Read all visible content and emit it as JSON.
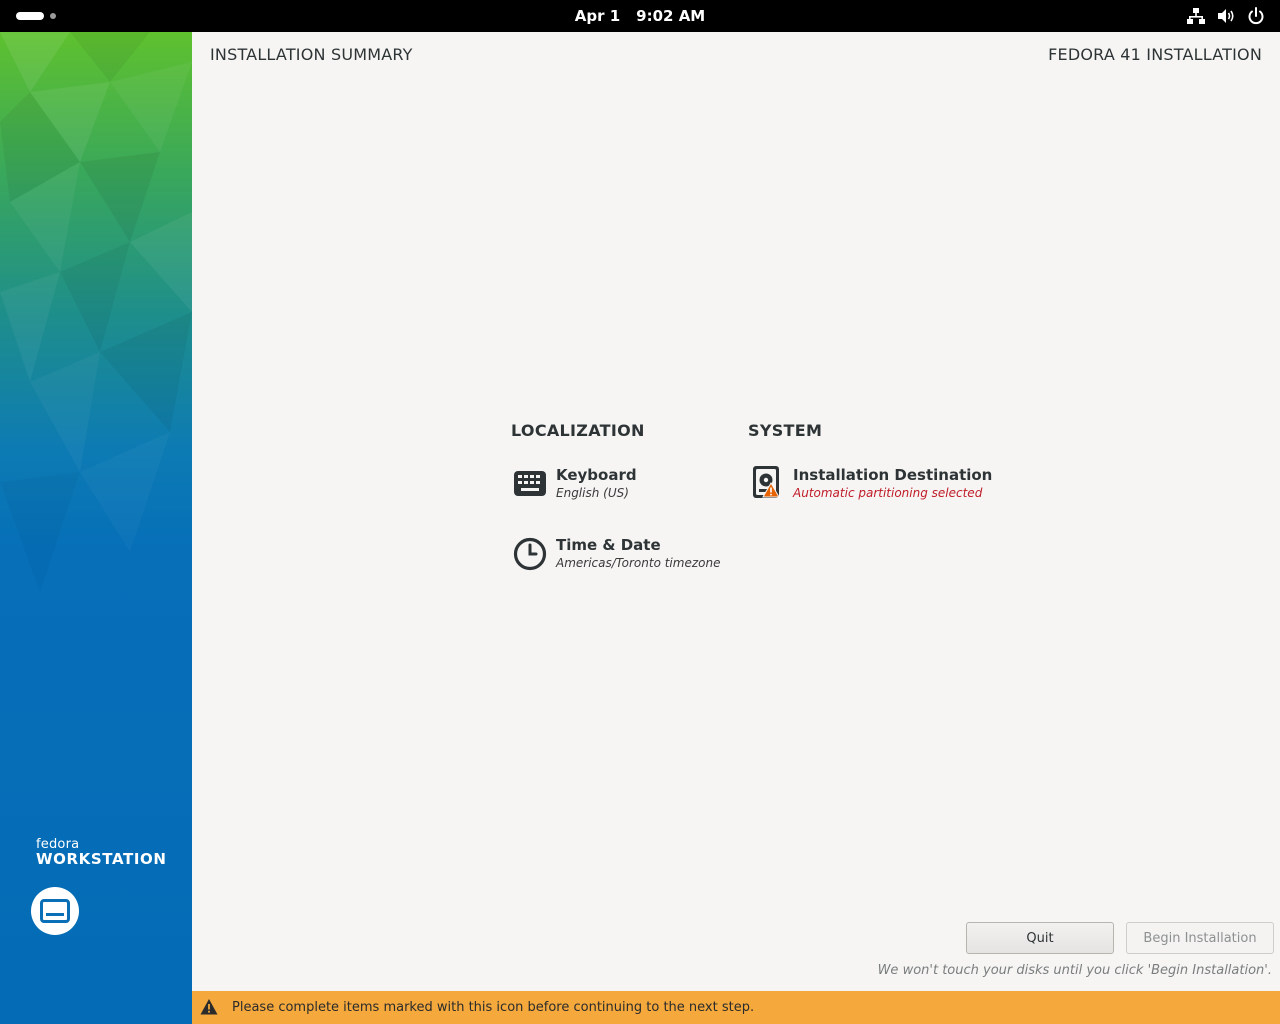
{
  "topbar": {
    "date": "Apr 1",
    "time": "9:02 AM",
    "tray_icons": [
      "network-icon",
      "volume-icon",
      "power-icon"
    ]
  },
  "sidebar": {
    "brand_line1": "fedora",
    "brand_line2": "WORKSTATION",
    "logo_icon": "anaconda-laptop-icon"
  },
  "header": {
    "title": "INSTALLATION SUMMARY",
    "product": "FEDORA 41 INSTALLATION"
  },
  "sections": {
    "localization": {
      "title": "LOCALIZATION",
      "spokes": [
        {
          "title": "Keyboard",
          "status": "English (US)",
          "icon": "keyboard-icon"
        },
        {
          "title": "Time & Date",
          "status": "Americas/Toronto timezone",
          "icon": "clock-icon"
        }
      ]
    },
    "system": {
      "title": "SYSTEM",
      "spokes": [
        {
          "title": "Installation Destination",
          "status": "Automatic partitioning selected",
          "icon": "disk-icon",
          "warning": true
        }
      ]
    }
  },
  "buttons": {
    "quit": "Quit",
    "begin": "Begin Installation"
  },
  "hint": "We won't touch your disks until you click 'Begin Installation'.",
  "warning_bar": {
    "text": "Please complete items marked with this icon before continuing to the next step.",
    "color": "#f5a93c"
  },
  "colors": {
    "error_text": "#c01c28",
    "sidebar_blue": "#046cb6",
    "sidebar_green": "#5fc12e"
  }
}
